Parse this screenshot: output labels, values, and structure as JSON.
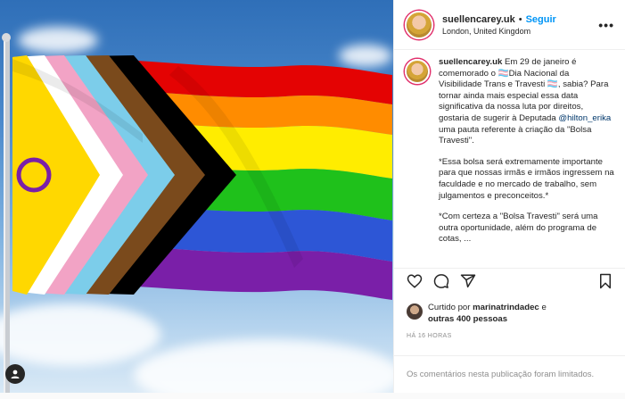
{
  "post": {
    "username": "suellencarey.uk",
    "follow_label": "Seguir",
    "separator": "•",
    "location": "London, United Kingdom",
    "more_label": "•••"
  },
  "caption": {
    "username": "suellencarey.uk",
    "p1_a": " Em 29 de janeiro é comemorado o 🏳️‍⚧️Dia Nacional da Visibilidade Trans e Travesti 🏳️‍⚧️, sabia? Para tornar ainda mais especial essa data significativa da nossa luta por direitos, gostaria de sugerir à Deputada ",
    "mention": "@hilton_erika",
    "p1_b": " uma pauta referente à criação da \"Bolsa Travesti\".",
    "p2": "*Essa bolsa será extremamente importante para que nossas irmãs e irmãos ingressem na faculdade e no mercado de trabalho, sem julgamentos e preconceitos.*",
    "p3": "*Com certeza a \"Bolsa Travesti\" será uma outra oportunidade, além do programa de cotas, ..."
  },
  "likes": {
    "prefix": "Curtido por ",
    "user": "marinatrindadec",
    "middle": " e",
    "others": "outras 400 pessoas"
  },
  "timestamp": "HÁ 16 HORAS",
  "comments_limited": "Os comentários nesta publicação foram limitados.",
  "icons": [
    "heart-icon",
    "comment-icon",
    "share-icon",
    "bookmark-icon",
    "user-tag-icon"
  ],
  "colors": {
    "follow": "#0095f6",
    "border": "#efefef",
    "muted": "#8e8e8e"
  }
}
